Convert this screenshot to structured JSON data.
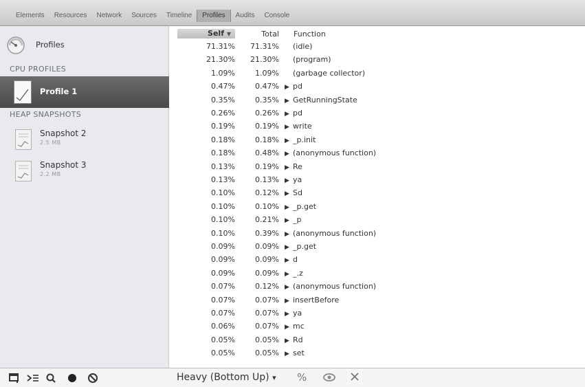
{
  "toolbar": {
    "tabs": [
      "Elements",
      "Resources",
      "Network",
      "Sources",
      "Timeline",
      "Profiles",
      "Audits",
      "Console"
    ],
    "active_tab": "Profiles"
  },
  "sidebar": {
    "root_label": "Profiles",
    "cpu_section": "CPU PROFILES",
    "cpu_profiles": [
      {
        "label": "Profile 1"
      }
    ],
    "heap_section": "HEAP SNAPSHOTS",
    "heap_snapshots": [
      {
        "name": "Snapshot 2",
        "size": "2.5 MB"
      },
      {
        "name": "Snapshot 3",
        "size": "2.2 MB"
      }
    ]
  },
  "grid": {
    "columns": {
      "self": "Self",
      "total": "Total",
      "function": "Function"
    },
    "sort_indicator": "▼",
    "rows": [
      {
        "self": "71.31%",
        "total": "71.31%",
        "function": "(idle)",
        "expandable": false
      },
      {
        "self": "21.30%",
        "total": "21.30%",
        "function": "(program)",
        "expandable": false
      },
      {
        "self": "1.09%",
        "total": "1.09%",
        "function": "(garbage collector)",
        "expandable": false
      },
      {
        "self": "0.47%",
        "total": "0.47%",
        "function": "pd",
        "expandable": true
      },
      {
        "self": "0.35%",
        "total": "0.35%",
        "function": "GetRunningState",
        "expandable": true
      },
      {
        "self": "0.26%",
        "total": "0.26%",
        "function": "pd",
        "expandable": true
      },
      {
        "self": "0.19%",
        "total": "0.19%",
        "function": "write",
        "expandable": true
      },
      {
        "self": "0.18%",
        "total": "0.18%",
        "function": "_p.init",
        "expandable": true
      },
      {
        "self": "0.18%",
        "total": "0.48%",
        "function": "(anonymous function)",
        "expandable": true
      },
      {
        "self": "0.13%",
        "total": "0.19%",
        "function": "Re",
        "expandable": true
      },
      {
        "self": "0.13%",
        "total": "0.13%",
        "function": "ya",
        "expandable": true
      },
      {
        "self": "0.10%",
        "total": "0.12%",
        "function": "Sd",
        "expandable": true
      },
      {
        "self": "0.10%",
        "total": "0.10%",
        "function": "_p.get",
        "expandable": true
      },
      {
        "self": "0.10%",
        "total": "0.21%",
        "function": "_p",
        "expandable": true
      },
      {
        "self": "0.10%",
        "total": "0.39%",
        "function": "(anonymous function)",
        "expandable": true
      },
      {
        "self": "0.09%",
        "total": "0.09%",
        "function": "_p.get",
        "expandable": true
      },
      {
        "self": "0.09%",
        "total": "0.09%",
        "function": "d",
        "expandable": true
      },
      {
        "self": "0.09%",
        "total": "0.09%",
        "function": "_.z",
        "expandable": true
      },
      {
        "self": "0.07%",
        "total": "0.12%",
        "function": "(anonymous function)",
        "expandable": true
      },
      {
        "self": "0.07%",
        "total": "0.07%",
        "function": "insertBefore",
        "expandable": true
      },
      {
        "self": "0.07%",
        "total": "0.07%",
        "function": "ya",
        "expandable": true
      },
      {
        "self": "0.06%",
        "total": "0.07%",
        "function": "mc",
        "expandable": true
      },
      {
        "self": "0.05%",
        "total": "0.05%",
        "function": "Rd",
        "expandable": true
      },
      {
        "self": "0.05%",
        "total": "0.05%",
        "function": "set",
        "expandable": true
      }
    ]
  },
  "statusbar": {
    "view_mode": "Heavy (Bottom Up)",
    "view_mode_arrow": "▾",
    "percent_label": "%",
    "icons": [
      "dock-icon",
      "console-icon",
      "search-icon",
      "record-icon",
      "clear-icon",
      "eye-icon",
      "close-icon"
    ]
  }
}
